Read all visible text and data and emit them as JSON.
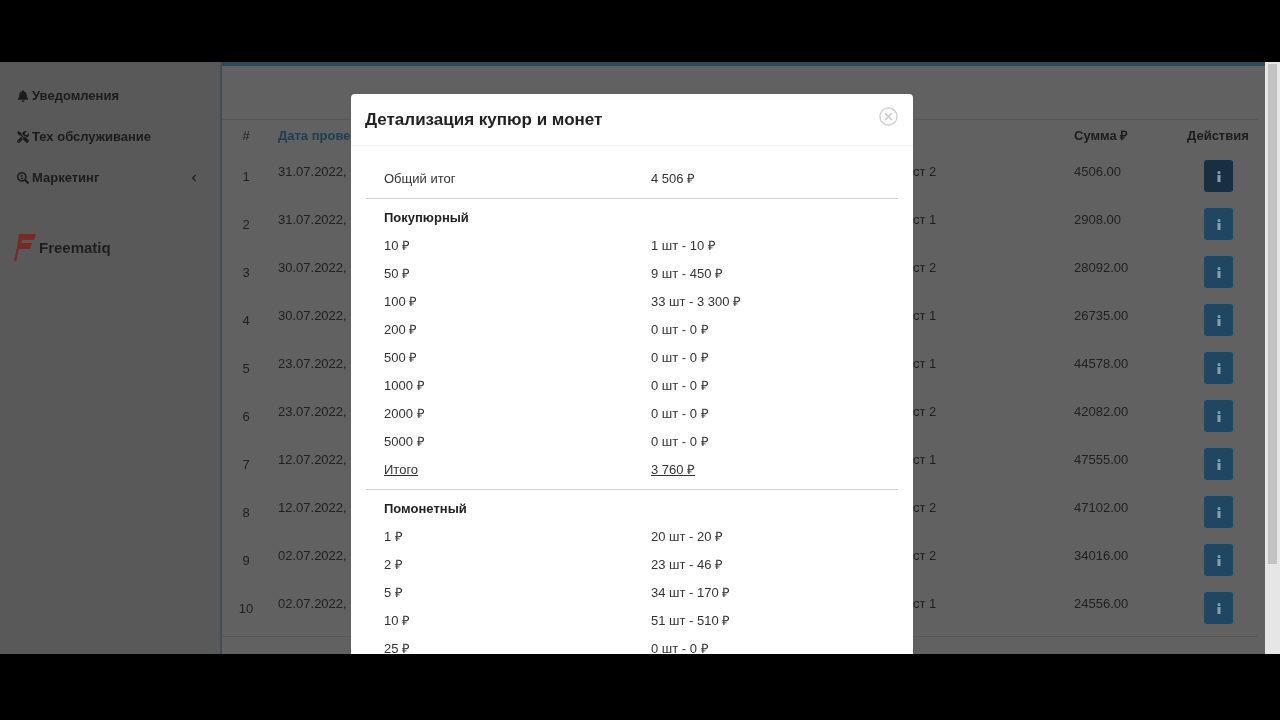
{
  "sidebar": {
    "items": [
      {
        "label": "Уведомления"
      },
      {
        "label": "Тех обслуживание"
      },
      {
        "label": "Маркетинг",
        "expanded": false
      }
    ],
    "logo": "Freematiq"
  },
  "table": {
    "columns": [
      {
        "label": "#"
      },
      {
        "label": "Дата прове"
      },
      {
        "label": "Сумма ₽"
      },
      {
        "label": "Действия"
      }
    ],
    "rows": [
      {
        "num": "1",
        "date": "31.07.2022,",
        "column_3": "ст 2",
        "sum": "4506.00",
        "hovered": true
      },
      {
        "num": "2",
        "date": "31.07.2022,",
        "column_3": "ст 1",
        "sum": "2908.00",
        "hovered": false
      },
      {
        "num": "3",
        "date": "30.07.2022,",
        "column_3": "ст 2",
        "sum": "28092.00",
        "hovered": false
      },
      {
        "num": "4",
        "date": "30.07.2022,",
        "column_3": "ст 1",
        "sum": "26735.00",
        "hovered": false
      },
      {
        "num": "5",
        "date": "23.07.2022,",
        "column_3": "ст 1",
        "sum": "44578.00",
        "hovered": false
      },
      {
        "num": "6",
        "date": "23.07.2022,",
        "column_3": "ст 2",
        "sum": "42082.00",
        "hovered": false
      },
      {
        "num": "7",
        "date": "12.07.2022,",
        "column_3": "ст 1",
        "sum": "47555.00",
        "hovered": false
      },
      {
        "num": "8",
        "date": "12.07.2022,",
        "column_3": "ст 2",
        "sum": "47102.00",
        "hovered": false
      },
      {
        "num": "9",
        "date": "02.07.2022,",
        "column_3": "ст 2",
        "sum": "34016.00",
        "hovered": false
      },
      {
        "num": "10",
        "date": "02.07.2022,",
        "column_3": "ст 1",
        "sum": "24556.00",
        "hovered": false
      }
    ]
  },
  "modal": {
    "title": "Детализация купюр и монет",
    "sections": [
      {
        "kind": "total",
        "label": "Общий итог",
        "value": "4 506 ₽"
      },
      {
        "kind": "group",
        "heading": "Покупюрный",
        "rows": [
          {
            "label": "10 ₽",
            "value": "1 шт - 10 ₽"
          },
          {
            "label": "50 ₽",
            "value": "9 шт - 450 ₽"
          },
          {
            "label": "100 ₽",
            "value": "33 шт - 3 300 ₽"
          },
          {
            "label": "200 ₽",
            "value": "0 шт - 0 ₽"
          },
          {
            "label": "500 ₽",
            "value": "0 шт - 0 ₽"
          },
          {
            "label": "1000 ₽",
            "value": "0 шт - 0 ₽"
          },
          {
            "label": "2000 ₽",
            "value": "0 шт - 0 ₽"
          },
          {
            "label": "5000 ₽",
            "value": "0 шт - 0 ₽"
          }
        ],
        "subtotal": {
          "label": "Итого",
          "value": "3 760 ₽"
        }
      },
      {
        "kind": "group",
        "heading": "Помонетный",
        "rows": [
          {
            "label": "1 ₽",
            "value": "20 шт - 20 ₽"
          },
          {
            "label": "2 ₽",
            "value": "23 шт - 46 ₽"
          },
          {
            "label": "5 ₽",
            "value": "34 шт - 170 ₽"
          },
          {
            "label": "10 ₽",
            "value": "51 шт - 510 ₽"
          },
          {
            "label": "25 ₽",
            "value": "0 шт - 0 ₽"
          }
        ]
      }
    ]
  }
}
